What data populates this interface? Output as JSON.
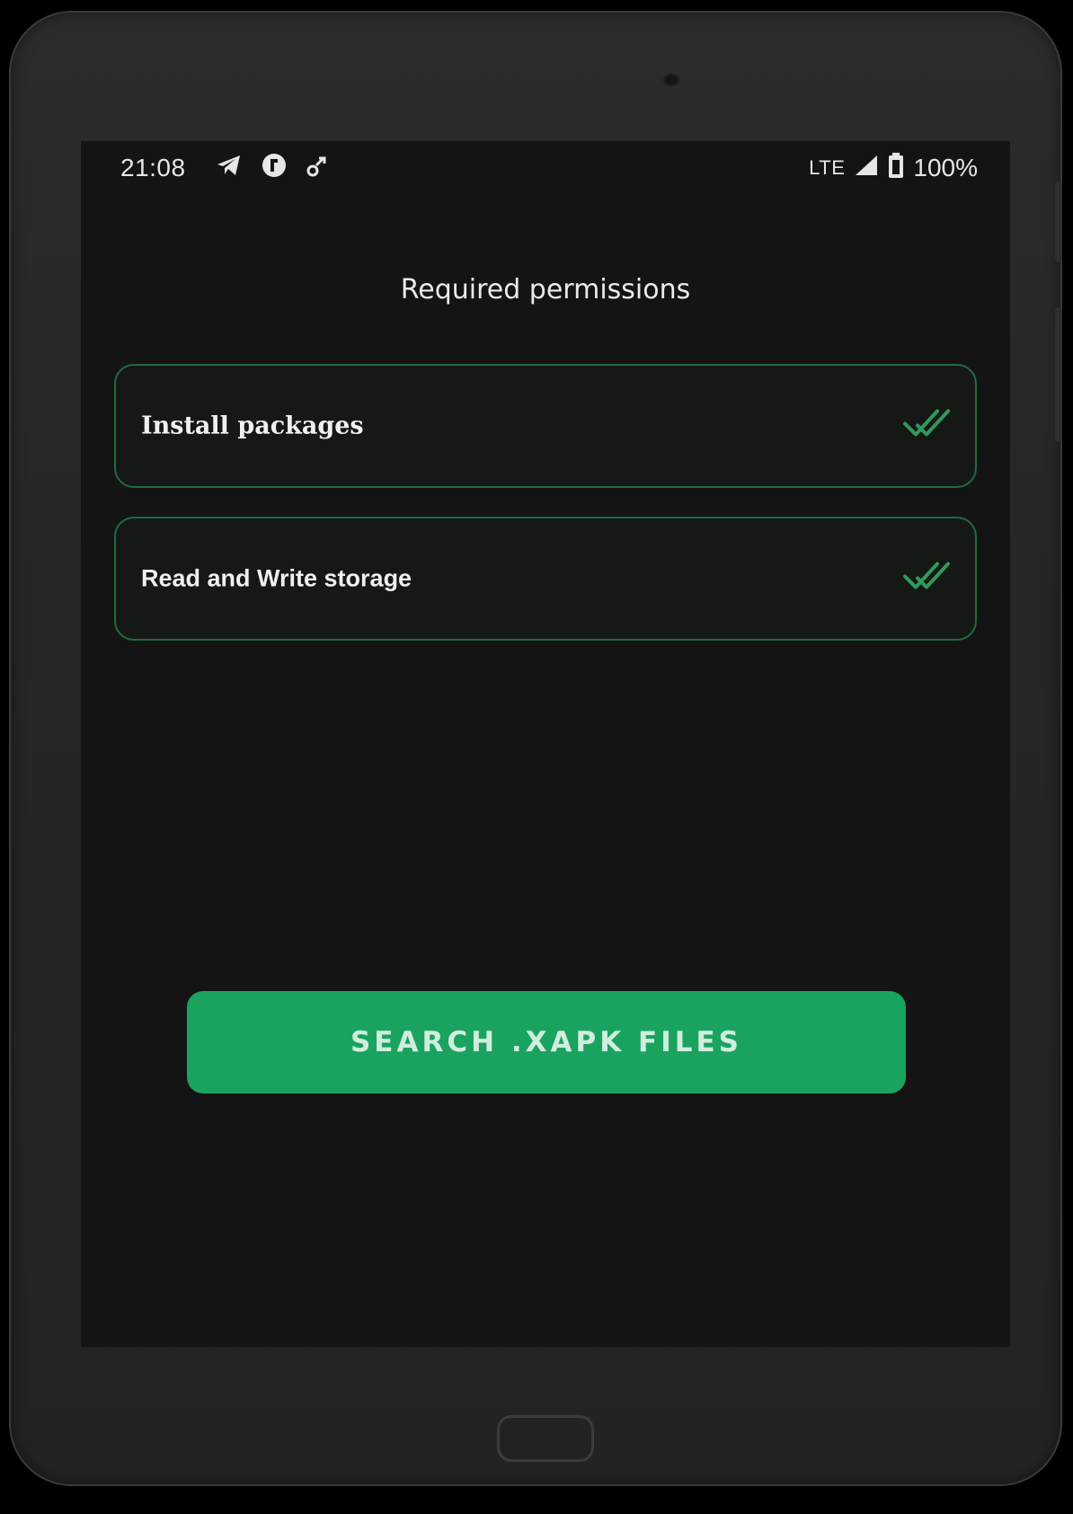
{
  "status_bar": {
    "time": "21:08",
    "left_icons": [
      "telegram-icon",
      "app-notification-icon",
      "link-icon"
    ],
    "network": "LTE",
    "battery_percent": "100%"
  },
  "screen": {
    "title": "Required permissions"
  },
  "permissions": [
    {
      "label": "Install packages",
      "granted": true,
      "check_icon": "double-check-icon"
    },
    {
      "label": "Read and Write storage",
      "granted": true,
      "check_icon": "double-check-icon"
    }
  ],
  "actions": {
    "search_label": "SEARCH .XAPK FILES"
  },
  "colors": {
    "accent": "#1aa35f",
    "card_border": "#1f6b40",
    "background": "#141414",
    "check": "#2f9a5c"
  }
}
